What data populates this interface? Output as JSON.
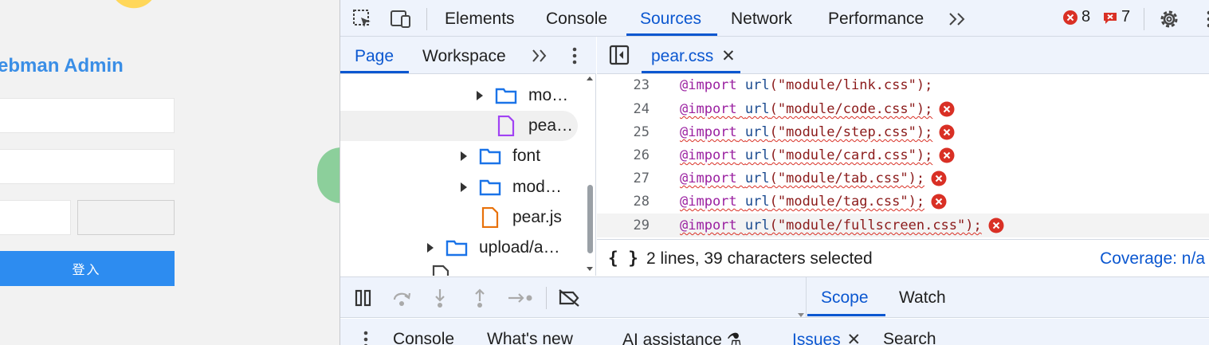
{
  "webpage": {
    "title": "ebman Admin",
    "login_button": "登入"
  },
  "devtools": {
    "main_tabs": [
      "Elements",
      "Console",
      "Sources",
      "Network",
      "Performance"
    ],
    "active_tab": "Sources",
    "error_count": "8",
    "issue_count": "7",
    "navigator": {
      "tabs": [
        "Page",
        "Workspace"
      ],
      "active_tab": "Page",
      "tree": [
        {
          "label": "mo…",
          "type": "folder",
          "expandable": true
        },
        {
          "label": "pea…",
          "type": "css-file",
          "selected": true
        },
        {
          "label": "font",
          "type": "folder",
          "expandable": true
        },
        {
          "label": "mod…",
          "type": "folder",
          "expandable": true
        },
        {
          "label": "pear.js",
          "type": "js-file"
        },
        {
          "label": "upload/a…",
          "type": "folder",
          "expandable": true
        }
      ]
    },
    "editor": {
      "open_file": "pear.css",
      "lines": [
        {
          "num": "23",
          "at": "@import",
          "fn": "url",
          "arg": "(\"module/link.css\");",
          "error": false
        },
        {
          "num": "24",
          "at": "@import",
          "fn": "url",
          "arg": "(\"module/code.css\");",
          "error": true
        },
        {
          "num": "25",
          "at": "@import",
          "fn": "url",
          "arg": "(\"module/step.css\");",
          "error": true
        },
        {
          "num": "26",
          "at": "@import",
          "fn": "url",
          "arg": "(\"module/card.css\");",
          "error": true
        },
        {
          "num": "27",
          "at": "@import",
          "fn": "url",
          "arg": "(\"module/tab.css\");",
          "error": true
        },
        {
          "num": "28",
          "at": "@import",
          "fn": "url",
          "arg": "(\"module/tag.css\");",
          "error": true
        },
        {
          "num": "29",
          "at": "@import",
          "fn": "url",
          "arg": "(\"module/fullscreen.css\");",
          "error": true
        }
      ],
      "status": "2 lines, 39 characters selected",
      "coverage": "Coverage: n/a"
    },
    "sidebar_tabs": [
      "Scope",
      "Watch"
    ],
    "drawer_tabs": [
      "Console",
      "What's new",
      "AI assistance ⚗",
      "Issues",
      "Search"
    ],
    "active_drawer_tab": "Issues",
    "colors": {
      "accent": "#0b57d0",
      "error": "#d93025",
      "toolbar_bg": "#eef3fc"
    }
  }
}
